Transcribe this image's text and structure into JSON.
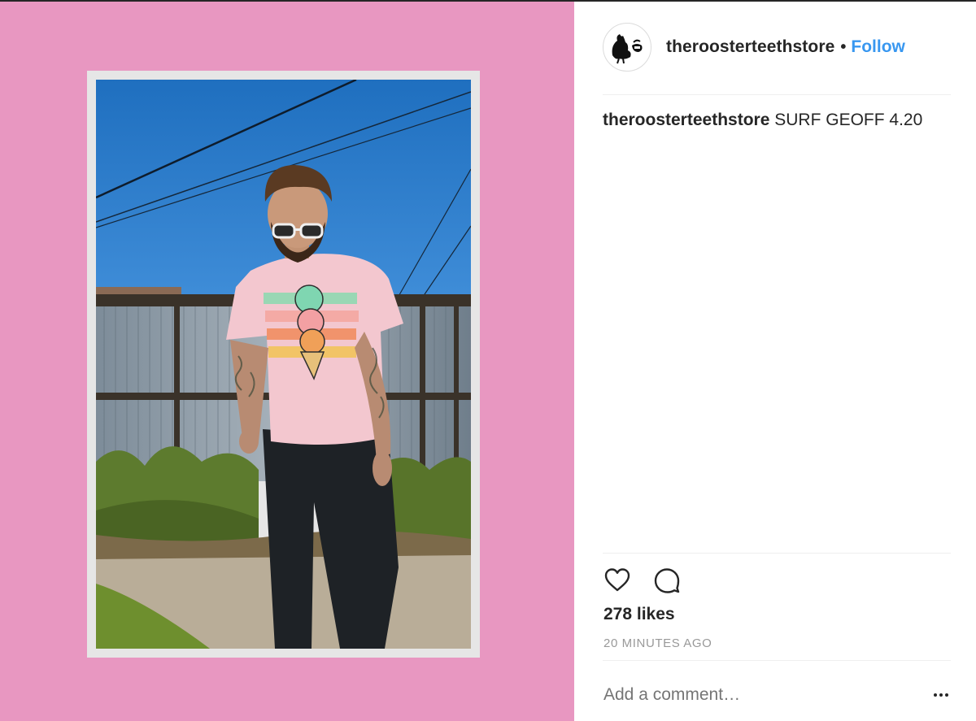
{
  "post": {
    "username": "theroosterteethstore",
    "separator": "•",
    "follow_label": "Follow",
    "caption_user": "theroosterteethstore",
    "caption_text": "SURF GEOFF 4.20",
    "likes": "278 likes",
    "timestamp": "20 MINUTES AGO",
    "comment_placeholder": "Add a comment…"
  },
  "icons": {
    "like": "heart-outline-icon",
    "comment": "speech-bubble-icon",
    "more": "ellipsis-icon",
    "avatar": "rooster-teeth-logo"
  },
  "colors": {
    "media_background": "#e897c1",
    "follow": "#3897f0",
    "text": "#262626",
    "muted": "#999999"
  }
}
